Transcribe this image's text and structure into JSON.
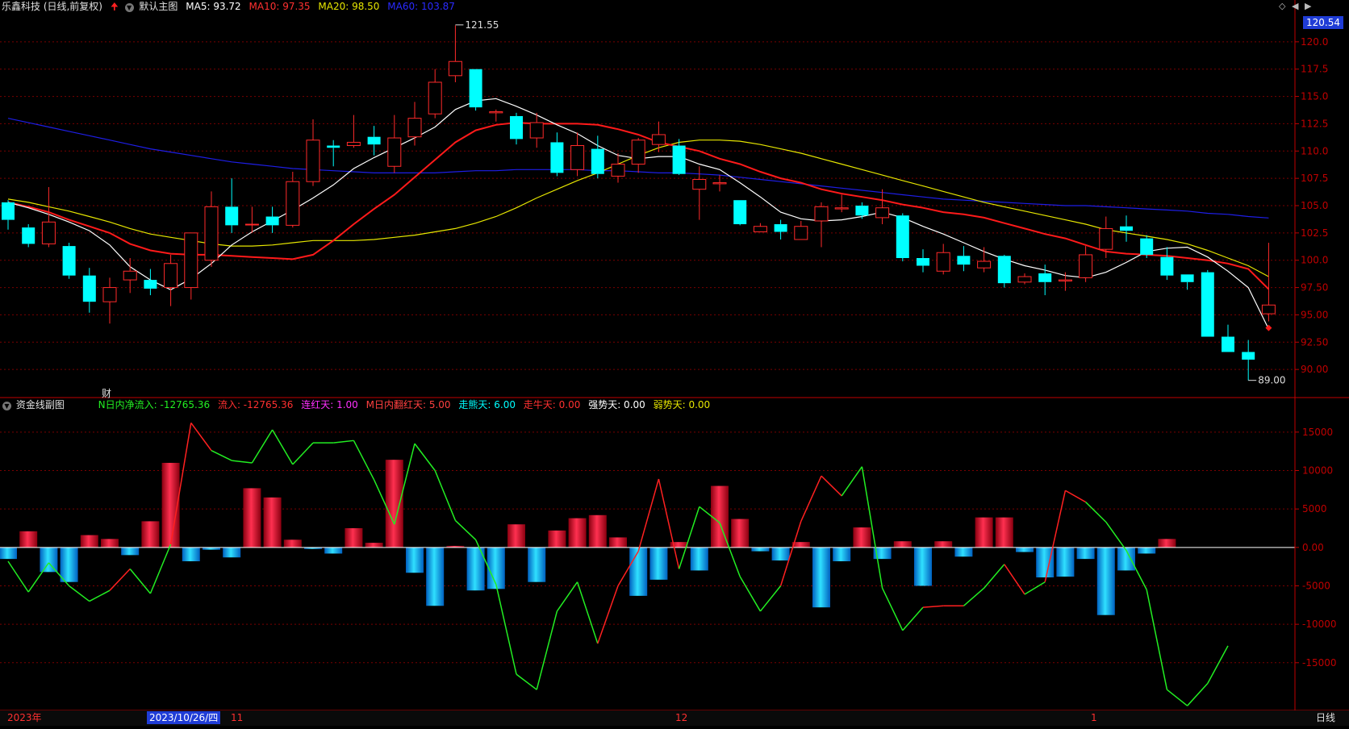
{
  "main_header": {
    "stock": "乐鑫科技 (日线,前复权)",
    "arrow": "up-arrow-icon",
    "chart_name": "默认主图",
    "ma5": "MA5: 93.72",
    "ma10": "MA10: 97.35",
    "ma20": "MA20: 98.50",
    "ma60": "MA60: 103.87"
  },
  "sub_header": {
    "name": "资金线副图",
    "net_inflow": "N日内净流入: -12765.36",
    "inflow": "流入: -12765.36",
    "lian_hong": "连红天: 1.00",
    "fan_hong": "M日内翻红天: 5.00",
    "zou_xiong": "走熊天: 6.00",
    "zou_niu": "走牛天: 0.00",
    "qiang_shi": "强势天: 0.00",
    "ruo_shi": "弱势天: 0.00"
  },
  "price_badge": "120.54",
  "marker_cai": "财",
  "bottom": {
    "year": "2023年",
    "cursor_date": "2023/10/26/四",
    "m11": "11",
    "m12": "12",
    "m1": "1",
    "period": "日线"
  },
  "colors": {
    "up": "#ff2a2a",
    "down": "#00ffff",
    "ma5": "#ffffff",
    "ma10": "#ff1a1a",
    "ma20": "#e6e600",
    "ma60": "#1e1ee6",
    "grid": "#7a0000",
    "axis": "#c00000"
  },
  "chart_data": [
    {
      "type": "candlestick",
      "title": "乐鑫科技 (日线,前复权)",
      "ylim": [
        87.5,
        122.5
      ],
      "yticks": [
        90,
        92.5,
        95,
        97.5,
        100,
        102.5,
        105,
        107.5,
        110,
        112.5,
        115,
        117.5,
        120
      ],
      "ytick_labels": [
        "90.00",
        "92.50",
        "95.00",
        "97.50",
        "100.0",
        "102.5",
        "105.0",
        "107.5",
        "110.0",
        "112.5",
        "115.0",
        "117.5",
        "120.0"
      ],
      "candles": [
        [
          105.3,
          103.7,
          105.5,
          102.8
        ],
        [
          103.0,
          101.5,
          103.3,
          101.2
        ],
        [
          101.5,
          103.5,
          106.7,
          101.2
        ],
        [
          101.3,
          98.6,
          101.6,
          98.3
        ],
        [
          98.6,
          96.2,
          99.3,
          95.2
        ],
        [
          96.2,
          97.5,
          98.4,
          94.2
        ],
        [
          98.2,
          99.0,
          100.2,
          97.0
        ],
        [
          98.2,
          97.4,
          99.2,
          96.8
        ],
        [
          97.5,
          99.7,
          100.5,
          95.8
        ],
        [
          97.5,
          102.5,
          102.5,
          96.4
        ],
        [
          100.0,
          104.9,
          106.3,
          99.4
        ],
        [
          104.9,
          103.2,
          107.5,
          102.5
        ],
        [
          103.3,
          103.3,
          104.9,
          102.5
        ],
        [
          104.0,
          103.2,
          104.9,
          102.5
        ],
        [
          103.2,
          107.2,
          108.1,
          103.0
        ],
        [
          107.2,
          111.0,
          112.9,
          106.8
        ],
        [
          110.5,
          110.3,
          111.0,
          108.6
        ],
        [
          110.5,
          110.8,
          113.3,
          110.3
        ],
        [
          111.3,
          110.6,
          112.3,
          109.6
        ],
        [
          108.6,
          111.2,
          113.3,
          108.0
        ],
        [
          111.3,
          113.0,
          114.5,
          110.5
        ],
        [
          113.4,
          116.3,
          117.5,
          113.0
        ],
        [
          116.9,
          118.2,
          121.5,
          116.3
        ],
        [
          117.5,
          114.0,
          117.5,
          113.7
        ],
        [
          113.5,
          113.6,
          113.8,
          112.7
        ],
        [
          113.2,
          111.1,
          113.5,
          110.6
        ],
        [
          111.2,
          112.6,
          113.5,
          110.3
        ],
        [
          110.8,
          108.0,
          111.7,
          107.7
        ],
        [
          108.3,
          110.5,
          111.7,
          107.7
        ],
        [
          110.2,
          107.9,
          111.4,
          107.5
        ],
        [
          107.7,
          108.8,
          109.8,
          107.1
        ],
        [
          108.8,
          111.0,
          111.2,
          108.0
        ],
        [
          110.6,
          111.5,
          112.7,
          109.9
        ],
        [
          110.5,
          107.9,
          111.1,
          107.8
        ],
        [
          106.5,
          107.4,
          108.6,
          103.7
        ],
        [
          107.0,
          107.1,
          107.8,
          106.3
        ],
        [
          105.5,
          103.3,
          105.5,
          103.2
        ],
        [
          102.6,
          103.1,
          103.4,
          102.6
        ],
        [
          103.3,
          102.6,
          103.7,
          101.9
        ],
        [
          101.9,
          103.1,
          103.6,
          101.9
        ],
        [
          103.6,
          104.9,
          105.3,
          101.2
        ],
        [
          104.7,
          104.8,
          106.0,
          104.4
        ],
        [
          105.0,
          104.1,
          105.3,
          103.8
        ],
        [
          103.9,
          104.8,
          106.5,
          103.3
        ],
        [
          104.1,
          100.2,
          104.3,
          99.9
        ],
        [
          100.2,
          99.5,
          101.0,
          98.9
        ],
        [
          99.0,
          100.7,
          101.5,
          98.7
        ],
        [
          100.4,
          99.6,
          101.3,
          99.0
        ],
        [
          99.3,
          99.9,
          101.2,
          98.9
        ],
        [
          100.4,
          97.9,
          100.5,
          97.5
        ],
        [
          98.0,
          98.5,
          98.8,
          97.8
        ],
        [
          98.8,
          98.0,
          99.6,
          96.8
        ],
        [
          98.1,
          98.2,
          98.9,
          97.2
        ],
        [
          98.4,
          100.5,
          101.3,
          98.0
        ],
        [
          101.0,
          102.9,
          104.0,
          100.2
        ],
        [
          103.1,
          102.7,
          104.1,
          101.7
        ],
        [
          102.0,
          100.5,
          102.3,
          100.2
        ],
        [
          100.3,
          98.6,
          101.2,
          98.2
        ],
        [
          98.7,
          98.0,
          98.7,
          97.3
        ],
        [
          98.9,
          93.0,
          99.1,
          93.0
        ],
        [
          93.0,
          91.6,
          94.1,
          91.6
        ],
        [
          91.6,
          90.9,
          92.7,
          89.0
        ],
        [
          95.1,
          95.9,
          101.6,
          94.4
        ]
      ],
      "ma5": [
        105.3,
        104.8,
        104.2,
        103.5,
        102.7,
        101.4,
        99.4,
        98.2,
        97.3,
        98.3,
        99.7,
        101.4,
        102.6,
        103.6,
        104.6,
        105.7,
        106.9,
        108.4,
        109.4,
        110.3,
        111.2,
        112.2,
        113.8,
        114.6,
        114.8,
        114.1,
        113.3,
        112.4,
        111.6,
        110.5,
        109.6,
        109.3,
        109.5,
        109.5,
        108.8,
        108.3,
        107.1,
        105.8,
        104.4,
        103.8,
        103.6,
        103.7,
        104.0,
        104.4,
        103.9,
        103.1,
        102.4,
        101.6,
        100.8,
        100.1,
        99.5,
        99.1,
        98.6,
        98.4,
        98.9,
        99.8,
        100.8,
        101.1,
        101.2,
        100.3,
        99.0,
        97.5,
        93.7
      ],
      "ma10": [
        105.3,
        104.9,
        104.4,
        103.7,
        103.1,
        102.5,
        101.5,
        100.9,
        100.6,
        100.5,
        100.5,
        100.4,
        100.3,
        100.2,
        100.1,
        100.5,
        101.8,
        103.3,
        104.7,
        106.0,
        107.6,
        109.2,
        110.8,
        111.9,
        112.4,
        112.6,
        112.5,
        112.5,
        112.5,
        112.4,
        112.0,
        111.5,
        110.8,
        110.4,
        110.0,
        109.3,
        108.8,
        108.1,
        107.5,
        107.1,
        106.5,
        106.1,
        105.8,
        105.5,
        105.1,
        104.8,
        104.4,
        104.2,
        103.9,
        103.4,
        102.9,
        102.4,
        102.0,
        101.4,
        100.8,
        100.6,
        100.5,
        100.4,
        100.2,
        100.0,
        99.7,
        99.2,
        97.35
      ],
      "ma20": [
        105.6,
        105.3,
        104.9,
        104.5,
        104.0,
        103.5,
        102.9,
        102.4,
        102.1,
        101.8,
        101.5,
        101.3,
        101.3,
        101.4,
        101.6,
        101.8,
        101.8,
        101.8,
        101.9,
        102.1,
        102.3,
        102.6,
        102.9,
        103.4,
        104.0,
        104.8,
        105.7,
        106.5,
        107.3,
        108.0,
        108.8,
        109.6,
        110.3,
        110.8,
        111.0,
        111.0,
        110.9,
        110.6,
        110.2,
        109.8,
        109.3,
        108.8,
        108.3,
        107.8,
        107.3,
        106.8,
        106.3,
        105.8,
        105.3,
        104.9,
        104.5,
        104.1,
        103.7,
        103.3,
        102.8,
        102.5,
        102.2,
        101.9,
        101.5,
        100.9,
        100.2,
        99.5,
        98.5
      ],
      "ma60": [
        113.0,
        112.6,
        112.2,
        111.8,
        111.4,
        111.0,
        110.6,
        110.2,
        109.9,
        109.6,
        109.3,
        109.0,
        108.8,
        108.6,
        108.4,
        108.3,
        108.2,
        108.1,
        108.0,
        108.0,
        108.0,
        108.0,
        108.1,
        108.2,
        108.2,
        108.3,
        108.3,
        108.3,
        108.3,
        108.2,
        108.2,
        108.1,
        108.0,
        108.0,
        107.9,
        107.8,
        107.6,
        107.4,
        107.2,
        107.0,
        106.8,
        106.6,
        106.4,
        106.2,
        106.0,
        105.8,
        105.6,
        105.5,
        105.4,
        105.3,
        105.2,
        105.1,
        105.0,
        105.0,
        104.9,
        104.8,
        104.7,
        104.6,
        104.5,
        104.3,
        104.2,
        104.0,
        103.87
      ],
      "annotations": [
        {
          "text": "121.55",
          "index": 22,
          "value": 121.55
        },
        {
          "text": "89.00",
          "index": 61,
          "value": 89.0
        }
      ]
    },
    {
      "type": "bar+line",
      "title": "资金线副图",
      "ylim": [
        -21000,
        17500
      ],
      "yticks": [
        15000,
        10000,
        5000,
        0,
        -5000,
        -10000,
        -15000
      ],
      "ytick_labels": [
        "15000",
        "10000",
        "5000",
        "0.00",
        "-5000",
        "-10000",
        "-15000"
      ],
      "bars": [
        -1500,
        2100,
        -3200,
        -4500,
        1600,
        1100,
        -1000,
        3400,
        11000,
        -1800,
        -300,
        -1300,
        7700,
        6500,
        1000,
        -200,
        -800,
        2500,
        600,
        11400,
        -3300,
        -7600,
        200,
        -5600,
        -5400,
        3000,
        -4500,
        2200,
        3800,
        4200,
        1300,
        -6300,
        -4200,
        700,
        -3000,
        8000,
        3700,
        -500,
        -1700,
        700,
        -7800,
        -1800,
        2600,
        -1500,
        800,
        -5000,
        800,
        -1200,
        3900,
        3900,
        -600,
        -3900,
        -3800,
        -1500,
        -8800,
        -3000,
        -800,
        1100
      ],
      "line": [
        -1800,
        -5800,
        -2000,
        -5000,
        -7000,
        -5600,
        -2800,
        -6000,
        400,
        16200,
        12600,
        11300,
        11000,
        15300,
        10800,
        13600,
        13600,
        13900,
        8800,
        3000,
        13500,
        10000,
        3500,
        1000,
        -4800,
        -16500,
        -18500,
        -8300,
        -4500,
        -12500,
        -5000,
        -500,
        8900,
        -2800,
        5300,
        3200,
        -3800,
        -8300,
        -5000,
        3400,
        9300,
        6700,
        10500,
        -5300,
        -10800,
        -7800,
        -7600,
        -7600,
        -5300,
        -2200,
        -6100,
        -4500,
        7400,
        5900,
        3300,
        -400,
        -5500,
        -18500,
        -20600,
        -17700,
        -12800
      ],
      "line_colors": [
        "g",
        "g",
        "g",
        "g",
        "g",
        "r",
        "g",
        "g",
        "r",
        "r",
        "g",
        "g",
        "g",
        "g",
        "g",
        "g",
        "g",
        "g",
        "g",
        "g",
        "g",
        "g",
        "g",
        "g",
        "g",
        "g",
        "g",
        "g",
        "g",
        "r",
        "r",
        "r",
        "r",
        "g",
        "g",
        "g",
        "g",
        "g",
        "r",
        "r",
        "r",
        "g",
        "g",
        "g",
        "g",
        "r",
        "r",
        "g",
        "g",
        "r",
        "g",
        "r",
        "r",
        "g",
        "g",
        "g",
        "g",
        "g",
        "g",
        "g",
        "r",
        "r"
      ]
    }
  ]
}
